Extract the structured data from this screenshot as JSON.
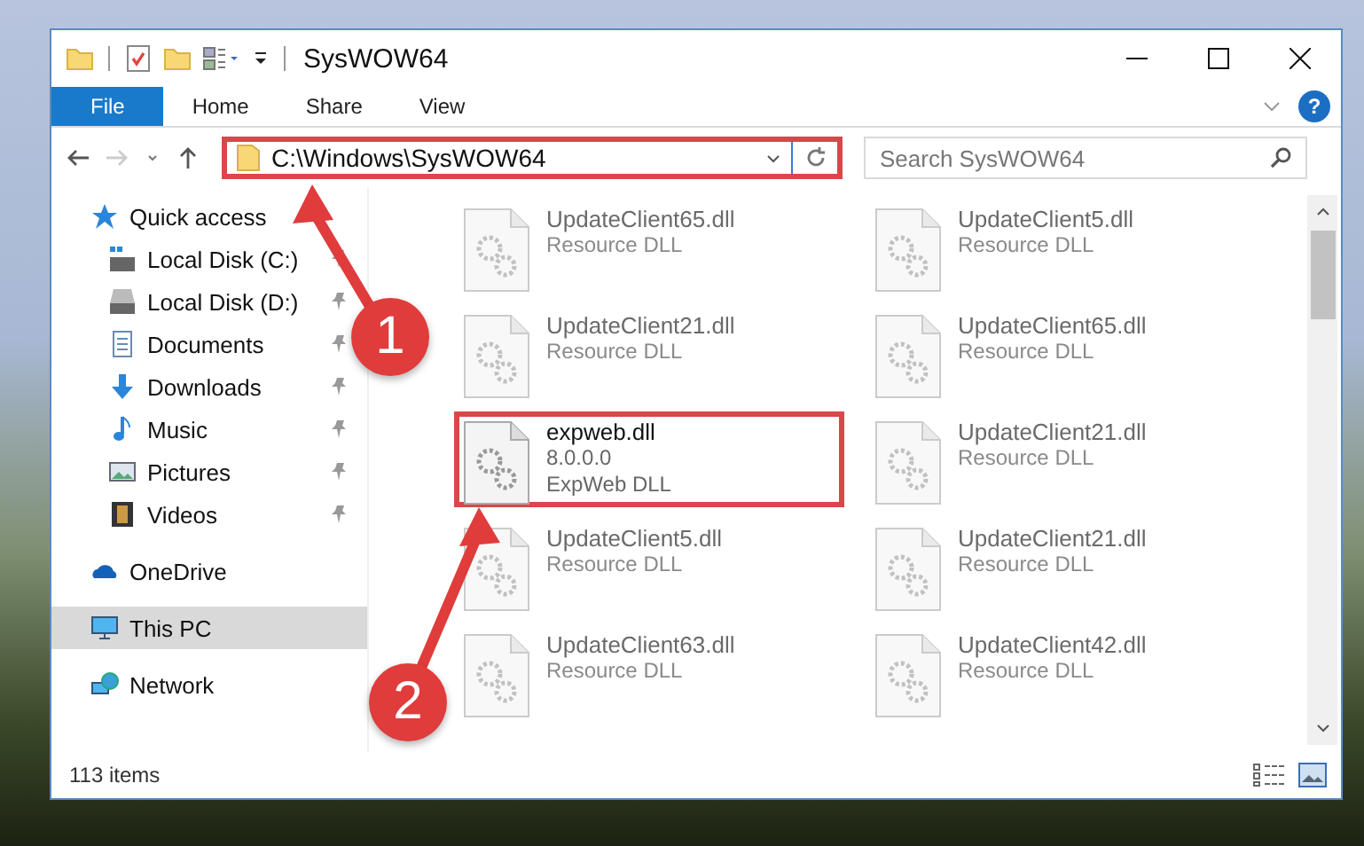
{
  "window": {
    "title": "SysWOW64"
  },
  "ribbon": {
    "tabs": [
      {
        "label": "File",
        "selected": true
      },
      {
        "label": "Home",
        "selected": false
      },
      {
        "label": "Share",
        "selected": false
      },
      {
        "label": "View",
        "selected": false
      }
    ],
    "help_button": "?"
  },
  "address_bar": {
    "path": "C:\\Windows\\SysWOW64",
    "highlighted": true
  },
  "search": {
    "placeholder": "Search SysWOW64"
  },
  "sidebar": {
    "items": [
      {
        "label": "Quick access",
        "kind": "star",
        "selected": false,
        "children": [
          {
            "label": "Local Disk (C:)",
            "kind": "system-drive",
            "pinned": true
          },
          {
            "label": "Local Disk (D:)",
            "kind": "drive",
            "pinned": true
          },
          {
            "label": "Documents",
            "kind": "documents",
            "pinned": true
          },
          {
            "label": "Downloads",
            "kind": "downloads",
            "pinned": true
          },
          {
            "label": "Music",
            "kind": "music",
            "pinned": true
          },
          {
            "label": "Pictures",
            "kind": "pictures",
            "pinned": true
          },
          {
            "label": "Videos",
            "kind": "videos",
            "pinned": true
          }
        ]
      },
      {
        "label": "OneDrive",
        "kind": "cloud",
        "selected": false
      },
      {
        "label": "This PC",
        "kind": "pc",
        "selected": true
      },
      {
        "label": "Network",
        "kind": "network",
        "selected": false
      }
    ]
  },
  "files": [
    {
      "name": "UpdateClient65.dll",
      "description": "Resource DLL",
      "highlighted": false
    },
    {
      "name": "UpdateClient5.dll",
      "description": "Resource DLL",
      "highlighted": false
    },
    {
      "name": "UpdateClient21.dll",
      "description": "Resource DLL",
      "highlighted": false
    },
    {
      "name": "UpdateClient65.dll",
      "description": "Resource DLL",
      "highlighted": false
    },
    {
      "name": "expweb.dll",
      "version": "8.0.0.0",
      "description": "ExpWeb DLL",
      "highlighted": true
    },
    {
      "name": "UpdateClient21.dll",
      "description": "Resource DLL",
      "highlighted": false
    },
    {
      "name": "UpdateClient5.dll",
      "description": "Resource DLL",
      "highlighted": false
    },
    {
      "name": "UpdateClient21.dll",
      "description": "Resource DLL",
      "highlighted": false
    },
    {
      "name": "UpdateClient63.dll",
      "description": "Resource DLL",
      "highlighted": false
    },
    {
      "name": "UpdateClient42.dll",
      "description": "Resource DLL",
      "highlighted": false
    }
  ],
  "status_bar": {
    "item_count": "113 items"
  },
  "annotations": [
    {
      "label": "1"
    },
    {
      "label": "2"
    }
  ]
}
